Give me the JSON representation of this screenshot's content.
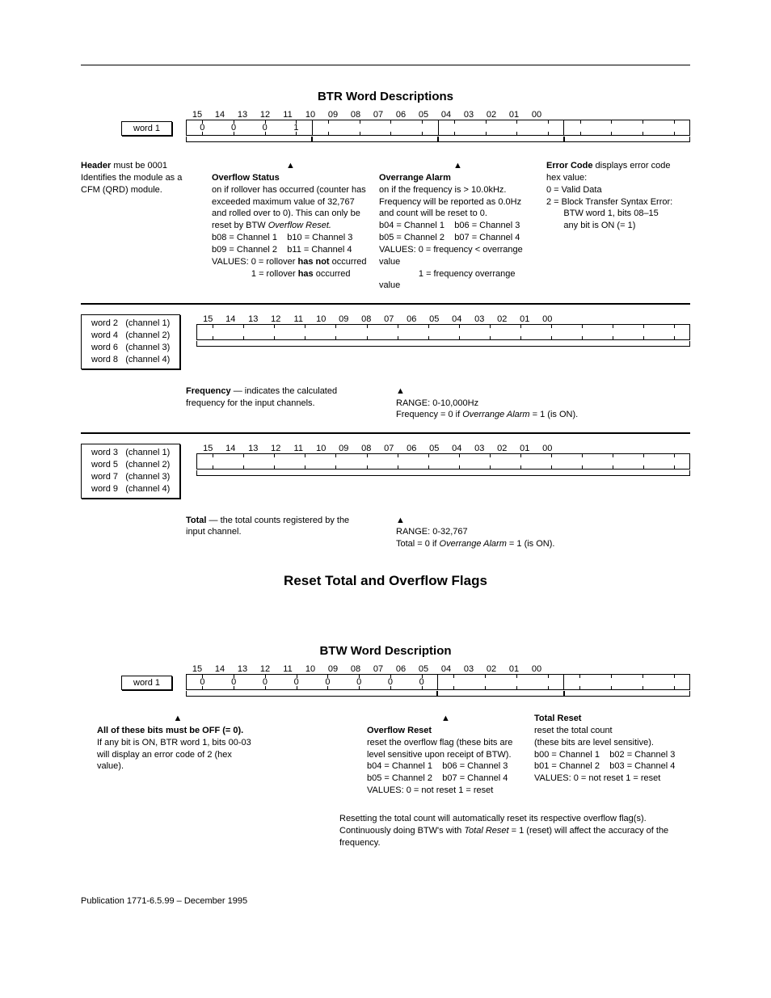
{
  "bits": [
    "15",
    "14",
    "13",
    "12",
    "11",
    "10",
    "09",
    "08",
    "07",
    "06",
    "05",
    "04",
    "03",
    "02",
    "01",
    "00"
  ],
  "btr": {
    "title": "BTR Word Descriptions",
    "word1_label": "word 1",
    "word1_vals": [
      "0",
      "0",
      "0",
      "1",
      "",
      "",
      "",
      "",
      "",
      "",
      "",
      "",
      "",
      "",
      "",
      ""
    ],
    "header": {
      "h": "Header",
      "t1": " must be 0001",
      "t2": "Identifies the module as a CFM (QRD) module."
    },
    "overflow": {
      "h": "Overflow Status",
      "l1": "on if rollover has occurred (counter has exceeded maximum value of 32,767 and rolled over to 0). This can only be reset by BTW",
      "l1b": "Overflow Reset.",
      "ch1": "b08 = Channel 1",
      "ch2": "b09 = Channel 2",
      "ch3": "b10 = Channel 3",
      "ch4": "b11 = Channel 4",
      "v0": "VALUES:  0 = rollover ",
      "v0b": "has not",
      "v0c": " occurred",
      "v1": "1 = rollover ",
      "v1b": "has",
      "v1c": " occurred"
    },
    "overrange": {
      "h": "Overrange Alarm",
      "l1": "on if the frequency is > 10.0kHz. Frequency will be reported as 0.0Hz and count will be reset to 0.",
      "ch1": "b04 = Channel 1",
      "ch2": "b05 = Channel 2",
      "ch3": "b06 = Channel 3",
      "ch4": "b07 = Channel 4",
      "v0": "VALUES:  0 = frequency < overrange value",
      "v1": "1 =  frequency    overrange value"
    },
    "error": {
      "h": "Error Code",
      "t1": " displays error code hex value:",
      "v0": "0 =  Valid Data",
      "v2a": "2 =  Block Transfer Syntax Error:",
      "v2b": "BTW word 1, bits 08–15",
      "v2c": "any bit is ON (= 1)"
    },
    "even_words": {
      "w2": "word 2",
      "w4": "word 4",
      "w6": "word 6",
      "w8": "word 8",
      "c1": "(channel 1)",
      "c2": "(channel 2)",
      "c3": "(channel 3)",
      "c4": "(channel 4)"
    },
    "frequency": {
      "h": "Frequency",
      "t": " — indicates the calculated frequency for the input channels.",
      "r1": "RANGE: 0-10,000Hz",
      "r2a": "Frequency = 0 if ",
      "r2b": "Overrange Alarm",
      "r2c": " = 1 (is ON)."
    },
    "odd_words": {
      "w3": "word 3",
      "w5": "word 5",
      "w7": "word 7",
      "w9": "word 9",
      "c1": "(channel 1)",
      "c2": "(channel 2)",
      "c3": "(channel 3)",
      "c4": "(channel 4)"
    },
    "total": {
      "h": "Total",
      "t": " — the total counts registered by the input channel.",
      "r1": "RANGE: 0-32,767",
      "r2a": "Total = 0 if ",
      "r2b": "Overrange Alarm",
      "r2c": " = 1 (is ON)."
    }
  },
  "reset_title": "Reset Total and Overflow Flags",
  "btw": {
    "title": "BTW Word Description",
    "word1_label": "word 1",
    "word1_vals": [
      "0",
      "0",
      "0",
      "0",
      "0",
      "0",
      "0",
      "0",
      "",
      "",
      "",
      "",
      "",
      "",
      "",
      ""
    ],
    "off": {
      "h": "All of these bits must be OFF (= 0).",
      "l1": "If any bit is ON, BTR word 1, bits 00-03 will display an error code of 2 (hex value)."
    },
    "oreset": {
      "h": "Overflow Reset",
      "l1": "reset the overflow flag (these bits are level sensitive upon receipt of BTW).",
      "ch1": "b04 = Channel 1",
      "ch2": "b05 = Channel 2",
      "ch3": "b06 = Channel 3",
      "ch4": "b07 = Channel 4",
      "v": "VALUES: 0 = not reset     1 = reset"
    },
    "treset": {
      "h": "Total Reset",
      "l1": "reset the total count",
      "l2": "(these bits are level sensitive).",
      "ch1": "b00 = Channel 1",
      "ch2": "b01 = Channel 2",
      "ch3": "b02 = Channel 3",
      "ch4": "b03 = Channel 4",
      "v": "VALUES: 0 = not reset     1 = reset"
    },
    "note1": "Resetting the total count will automatically reset its respective overflow flag(s).",
    "note2a": "Continuously doing BTW's with ",
    "note2b": "Total Reset",
    "note2c": " = 1 (reset) will affect the accuracy of the frequency."
  },
  "publication": "Publication 1771-6.5.99 – December 1995"
}
